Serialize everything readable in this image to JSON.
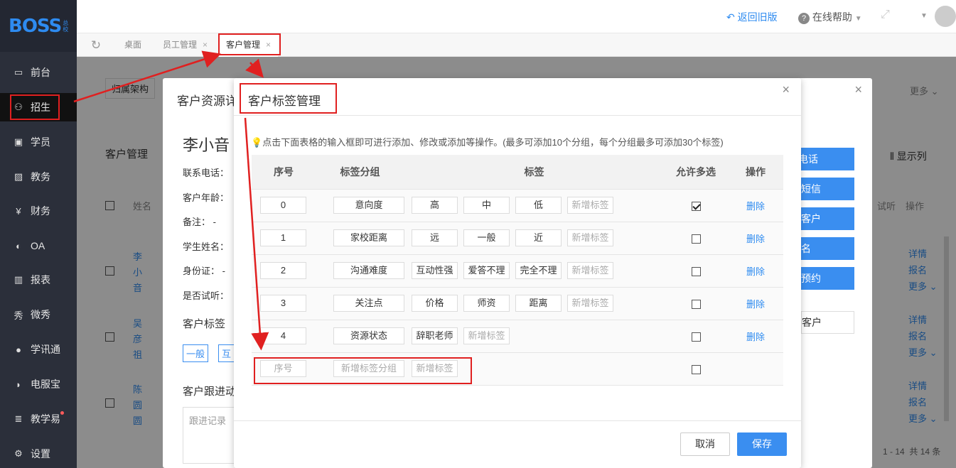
{
  "brand": {
    "logo": "BOSS",
    "logo_sub": "总校"
  },
  "sidebar": {
    "items": [
      {
        "label": "前台",
        "icon": "calendar-icon"
      },
      {
        "label": "招生",
        "icon": "user-add-icon"
      },
      {
        "label": "学员",
        "icon": "student-card-icon"
      },
      {
        "label": "教务",
        "icon": "image-icon"
      },
      {
        "label": "财务",
        "icon": "yen-icon"
      },
      {
        "label": "OA",
        "icon": "oa-icon"
      },
      {
        "label": "报表",
        "icon": "bar-chart-icon"
      },
      {
        "label": "微秀",
        "icon": "xiu-icon"
      },
      {
        "label": "学讯通",
        "icon": "location-icon"
      },
      {
        "label": "电服宝",
        "icon": "phone-icon"
      },
      {
        "label": "教学易",
        "icon": "book-icon"
      },
      {
        "label": "设置",
        "icon": "gear-icon"
      }
    ]
  },
  "topbar": {
    "back_old": "返回旧版",
    "help": "在线帮助"
  },
  "tabs": [
    {
      "label": "桌面"
    },
    {
      "label": "员工管理"
    },
    {
      "label": "客户管理"
    }
  ],
  "background": {
    "filter_label": "归属架构",
    "more": "更多",
    "list_title": "客户管理",
    "display_cols": "显示列",
    "col_name": "姓名",
    "col_trial": "试听",
    "col_ops": "操作",
    "rows": [
      {
        "name": "李\n小\n音",
        "ops": [
          "详情",
          "报名",
          "更多"
        ]
      },
      {
        "name": "吴\n彦\n祖",
        "ops": [
          "详情",
          "报名",
          "更多"
        ]
      },
      {
        "name": "陈\n圆\n圆",
        "ops": [
          "详情",
          "报名",
          "更多"
        ]
      }
    ],
    "pagination": "1 - 14  共 14 条"
  },
  "detail": {
    "title": "客户资源详",
    "name": "李小音",
    "fields": [
      "联系电话：",
      "客户年龄：",
      "备注：  -",
      "学生姓名：",
      "身份证：  -",
      "是否试听："
    ],
    "tags_label": "客户标签",
    "tag_chips": [
      "一般",
      "互"
    ],
    "followup_label": "客户跟进动",
    "followup_placeholder": "跟进记录",
    "actions": [
      "电话",
      "短信",
      "客户",
      "名",
      "预约"
    ],
    "customer_box": "客户"
  },
  "modal": {
    "title": "客户标签管理",
    "hint": "点击下面表格的输入框即可进行添加、修改或添加等操作。(最多可添加10个分组，每个分组最多可添加30个标签)",
    "headers": [
      "序号",
      "标签分组",
      "标签",
      "允许多选",
      "操作"
    ],
    "rows": [
      {
        "seq": "0",
        "group": "意向度",
        "tags": [
          "高",
          "中",
          "低"
        ],
        "multi": true,
        "op": "删除"
      },
      {
        "seq": "1",
        "group": "家校距离",
        "tags": [
          "远",
          "一般",
          "近"
        ],
        "multi": false,
        "op": "删除"
      },
      {
        "seq": "2",
        "group": "沟通难度",
        "tags": [
          "互动性强",
          "爱答不理",
          "完全不理"
        ],
        "multi": false,
        "op": "删除"
      },
      {
        "seq": "3",
        "group": "关注点",
        "tags": [
          "价格",
          "师资",
          "距离"
        ],
        "multi": false,
        "op": "删除"
      },
      {
        "seq": "4",
        "group": "资源状态",
        "tags": [
          "辞职老师"
        ],
        "multi": false,
        "op": "删除"
      }
    ],
    "new_tag_placeholder": "新增标签",
    "new_row": {
      "seq_placeholder": "序号",
      "group_placeholder": "新增标签分组",
      "tag_placeholder": "新增标签"
    },
    "cancel": "取消",
    "save": "保存"
  }
}
